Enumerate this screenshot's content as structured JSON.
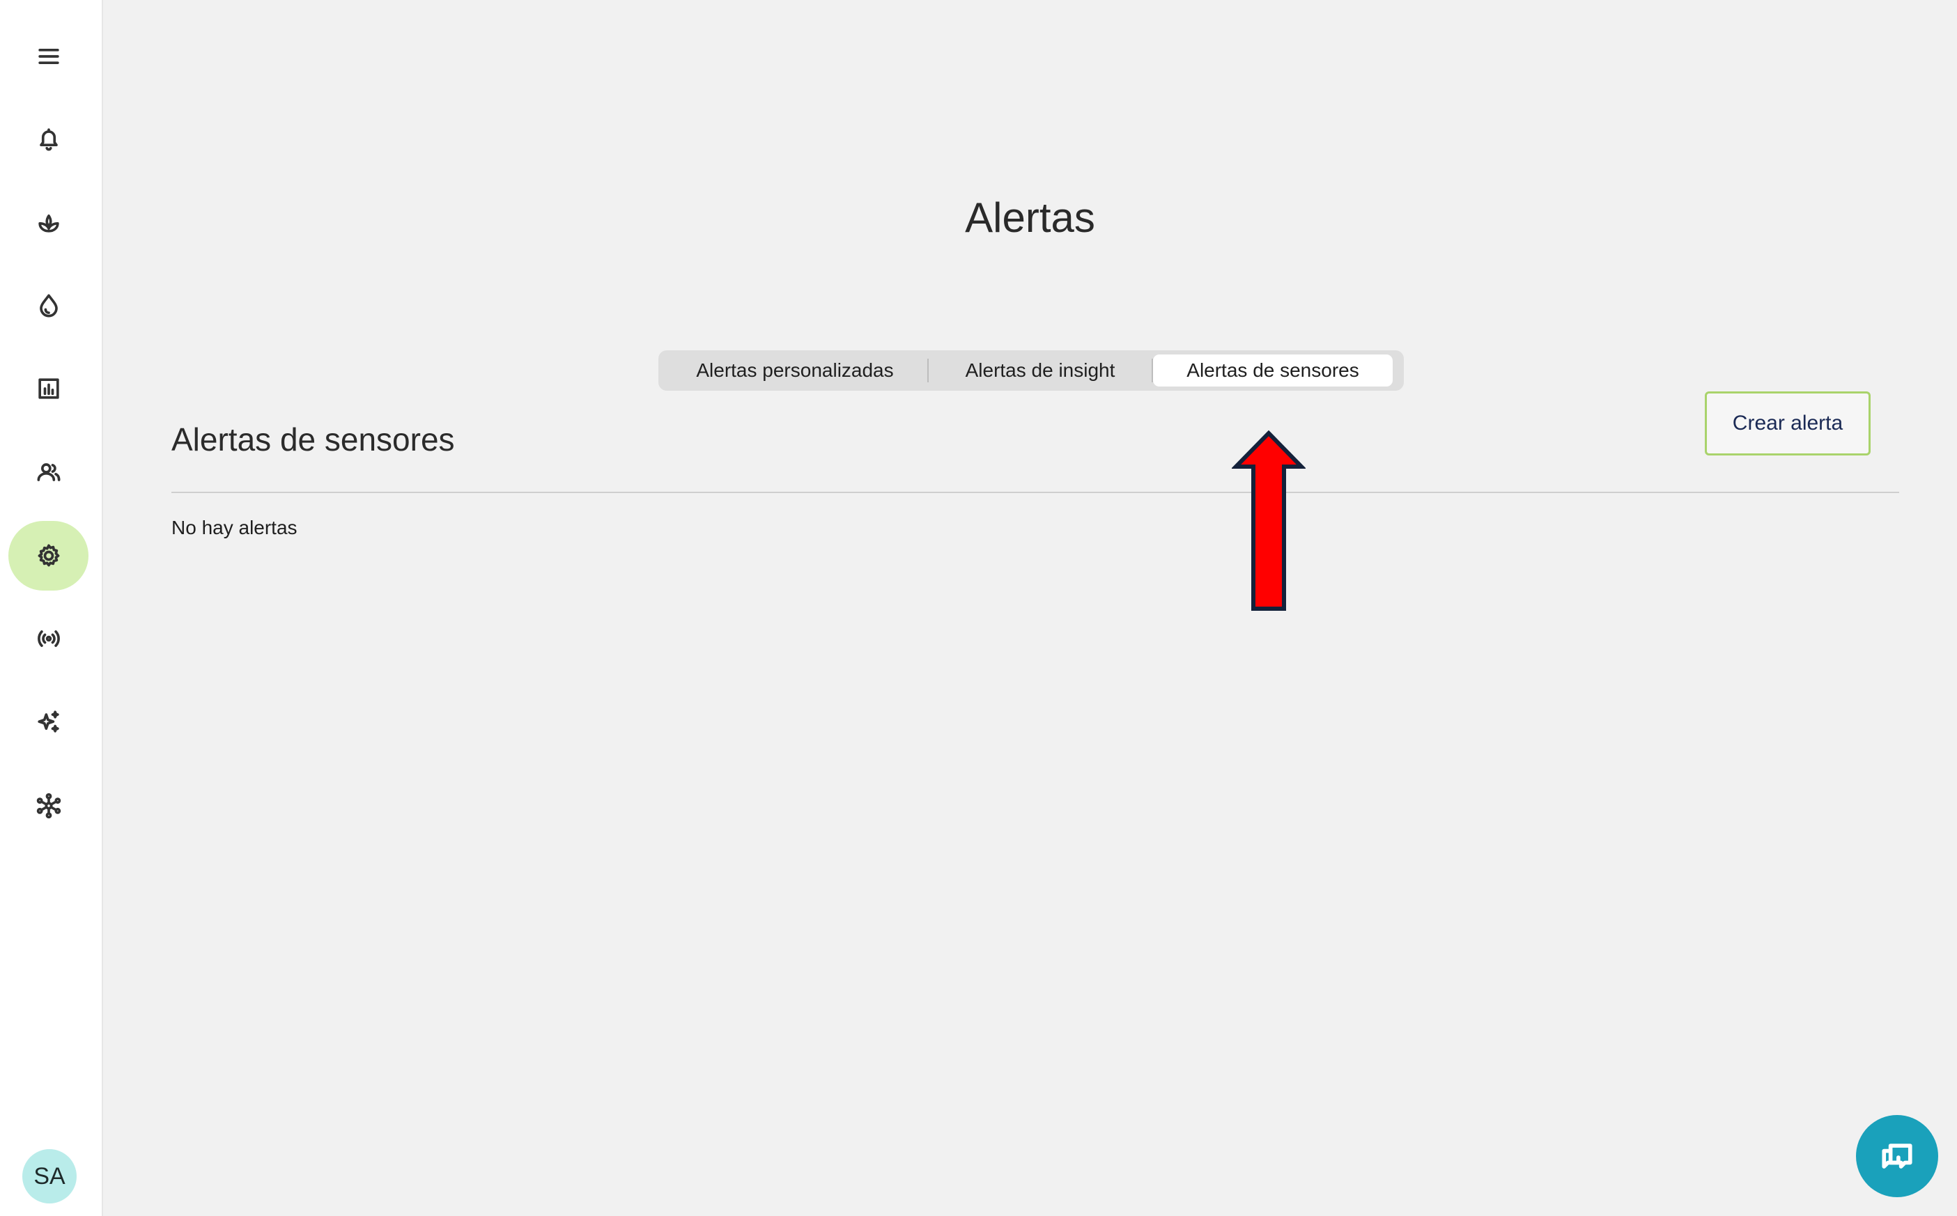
{
  "sidebar": {
    "items": [
      {
        "icon": "menu-icon"
      },
      {
        "icon": "bell-icon"
      },
      {
        "icon": "plant-icon"
      },
      {
        "icon": "water-drop-icon"
      },
      {
        "icon": "bar-chart-icon"
      },
      {
        "icon": "users-icon"
      },
      {
        "icon": "gear-icon",
        "active": true
      },
      {
        "icon": "sensor-broadcast-icon"
      },
      {
        "icon": "sparkles-icon"
      },
      {
        "icon": "network-icon"
      }
    ],
    "avatar_initials": "SA"
  },
  "main": {
    "title": "Alertas",
    "tabs": [
      {
        "label": "Alertas personalizadas"
      },
      {
        "label": "Alertas de insight"
      },
      {
        "label": "Alertas de sensores",
        "selected": true
      }
    ],
    "section_title": "Alertas de sensores",
    "create_button": "Crear alerta",
    "empty_message": "No hay alertas"
  },
  "colors": {
    "active_nav_bg": "#d6f0b4",
    "create_button_border": "#a9d36b",
    "chat_fab": "#1aa1bb",
    "avatar_bg": "#b9ecea",
    "annotation_arrow": "#ff0000"
  },
  "chat_fab_icon": "chat-bubbles-icon"
}
